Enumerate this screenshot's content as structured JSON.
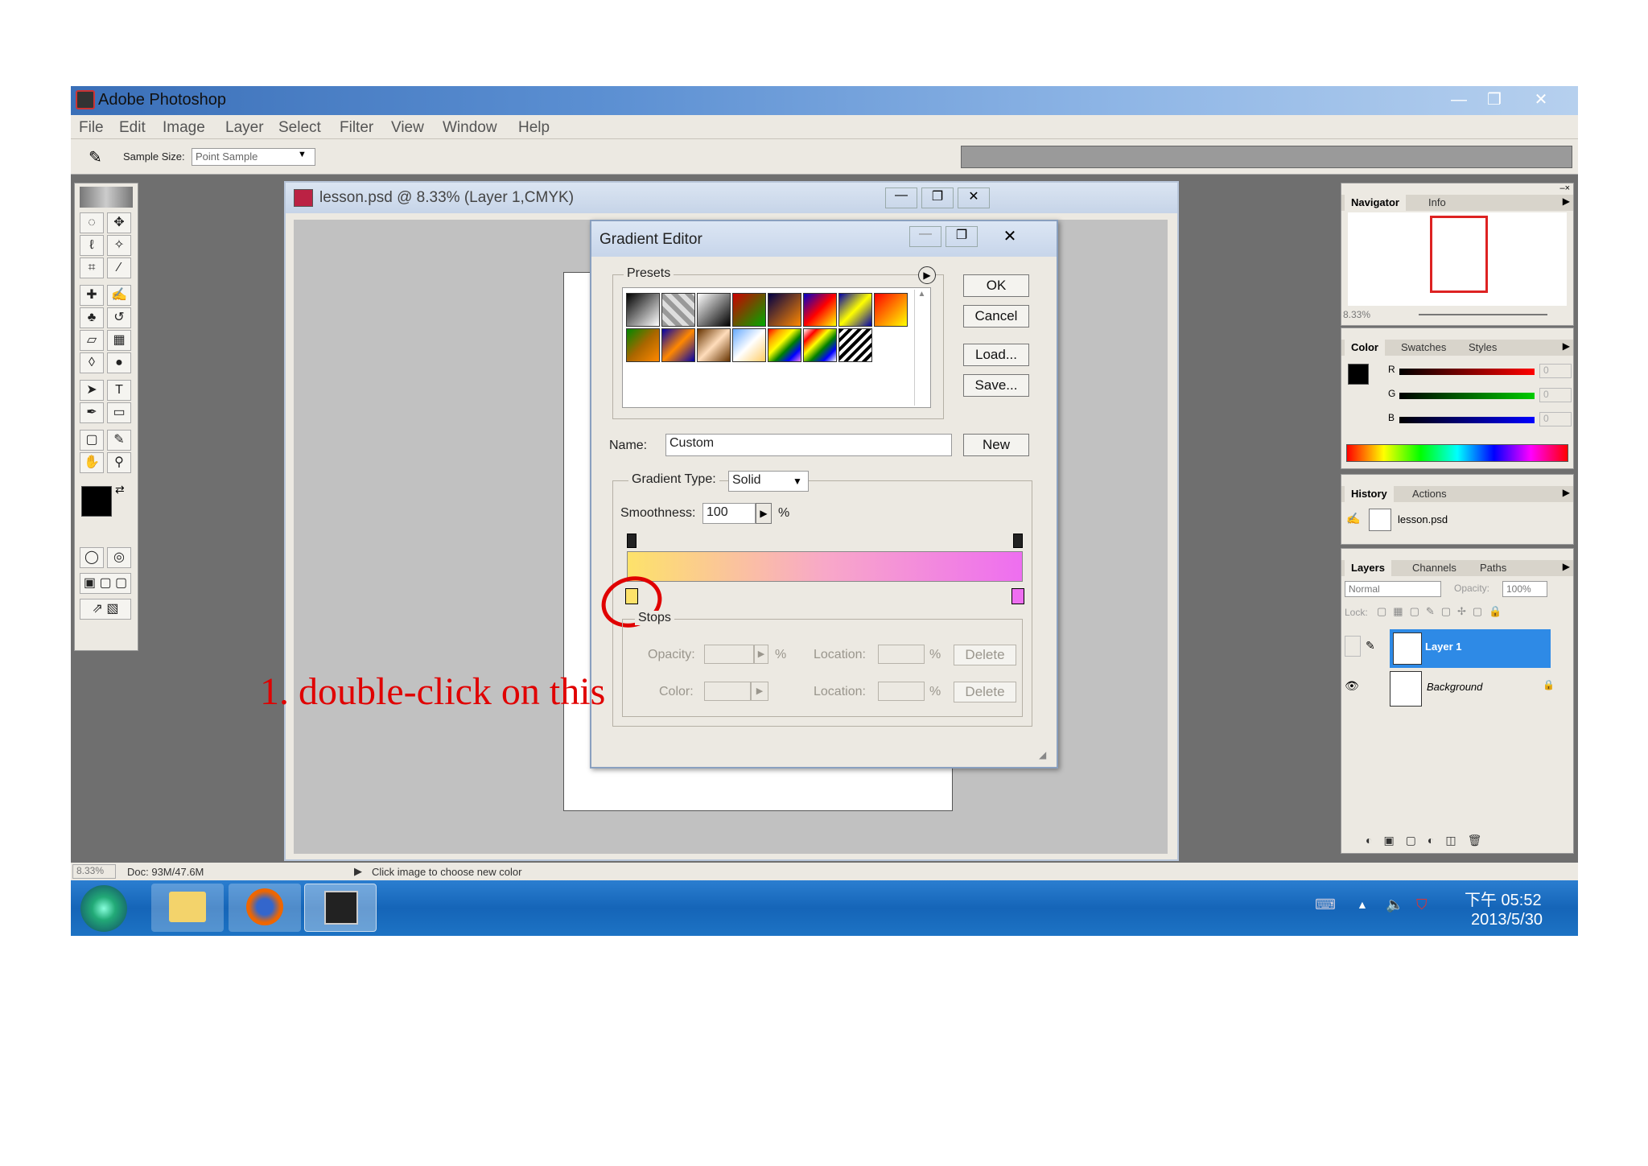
{
  "window": {
    "title": "Adobe Photoshop",
    "min_glyph": "—",
    "max_glyph": "❐",
    "close_glyph": "✕"
  },
  "menu": [
    "File",
    "Edit",
    "Image",
    "Layer",
    "Select",
    "Filter",
    "View",
    "Window",
    "Help"
  ],
  "options_bar": {
    "sample_size_label": "Sample Size:",
    "sample_size_value": "Point Sample"
  },
  "document": {
    "title": "lesson.psd @ 8.33% (Layer 1,CMYK)"
  },
  "gradient_editor": {
    "title": "Gradient Editor",
    "presets_label": "Presets",
    "ok_label": "OK",
    "cancel_label": "Cancel",
    "load_label": "Load...",
    "save_label": "Save...",
    "name_label": "Name:",
    "name_value": "Custom",
    "new_label": "New",
    "gradient_type_label": "Gradient Type:",
    "gradient_type_value": "Solid",
    "smoothness_label": "Smoothness:",
    "smoothness_value": "100",
    "smoothness_unit": "%",
    "stops_label": "Stops",
    "opacity_label": "Opacity:",
    "location_label": "Location:",
    "percent": "%",
    "color_label": "Color:",
    "delete_label": "Delete",
    "gradient_start_color": "#fde26a",
    "gradient_mid_color": "#f8a8c8",
    "gradient_end_color": "#ee6ef0"
  },
  "annotation": {
    "text": "1. double-click on this",
    "color": "#e00000"
  },
  "navigator_panel": {
    "tabs": [
      "Navigator",
      "Info"
    ],
    "zoom": "8.33%"
  },
  "color_panel": {
    "tabs": [
      "Color",
      "Swatches",
      "Styles"
    ],
    "r_label": "R",
    "g_label": "G",
    "b_label": "B",
    "r_value": "0",
    "g_value": "0",
    "b_value": "0"
  },
  "history_panel": {
    "tabs": [
      "History",
      "Actions"
    ],
    "item": "lesson.psd"
  },
  "layers_panel": {
    "tabs": [
      "Layers",
      "Channels",
      "Paths"
    ],
    "blend_mode": "Normal",
    "opacity_label": "Opacity:",
    "opacity_value": "100%",
    "lock_label": "Lock:",
    "layers": [
      "Layer 1",
      "Background"
    ]
  },
  "status_bar": {
    "zoom": "8.33%",
    "doc": "Doc: 93M/47.6M",
    "hint": "Click image to choose new color"
  },
  "taskbar": {
    "time": "下午 05:52",
    "date": "2013/5/30"
  }
}
